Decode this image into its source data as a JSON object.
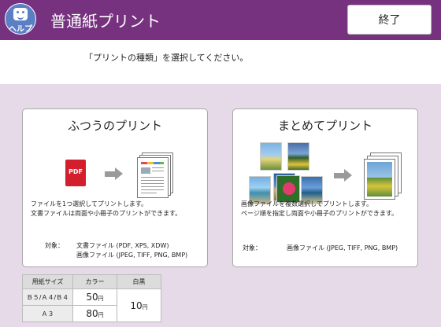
{
  "header": {
    "help_label": "ヘルプ",
    "title": "普通紙プリント",
    "end_label": "終了"
  },
  "instruction": "「プリントの種類」を選択してください。",
  "cards": [
    {
      "title": "ふつうのプリント",
      "icon": "PDF",
      "desc1": "ファイルを1つ選択してプリントします。",
      "desc2": "文書ファイルは両面や小冊子のプリントができます。",
      "target_label": "対象：",
      "target1": "文書ファイル (PDF, XPS, XDW)",
      "target2": "画像ファイル (JPEG, TIFF, PNG, BMP)"
    },
    {
      "title": "まとめてプリント",
      "desc1": "画像ファイルを複数選択してプリントします。",
      "desc2": "ページ順を指定し両面や小冊子のプリントができます。",
      "target_label": "対象：",
      "target1": "画像ファイル (JPEG, TIFF, PNG, BMP)"
    }
  ],
  "price_table": {
    "headers": [
      "用紙サイズ",
      "カラー",
      "白黒"
    ],
    "rows": [
      {
        "size": "Ｂ５/Ａ４/Ｂ４",
        "color": "50",
        "bw": "10"
      },
      {
        "size": "Ａ３",
        "color": "80"
      }
    ],
    "unit": "円"
  },
  "colors": {
    "header_bg": "#76317f",
    "page_bg": "#e6d9e8",
    "pdf_red": "#d21f2b"
  }
}
